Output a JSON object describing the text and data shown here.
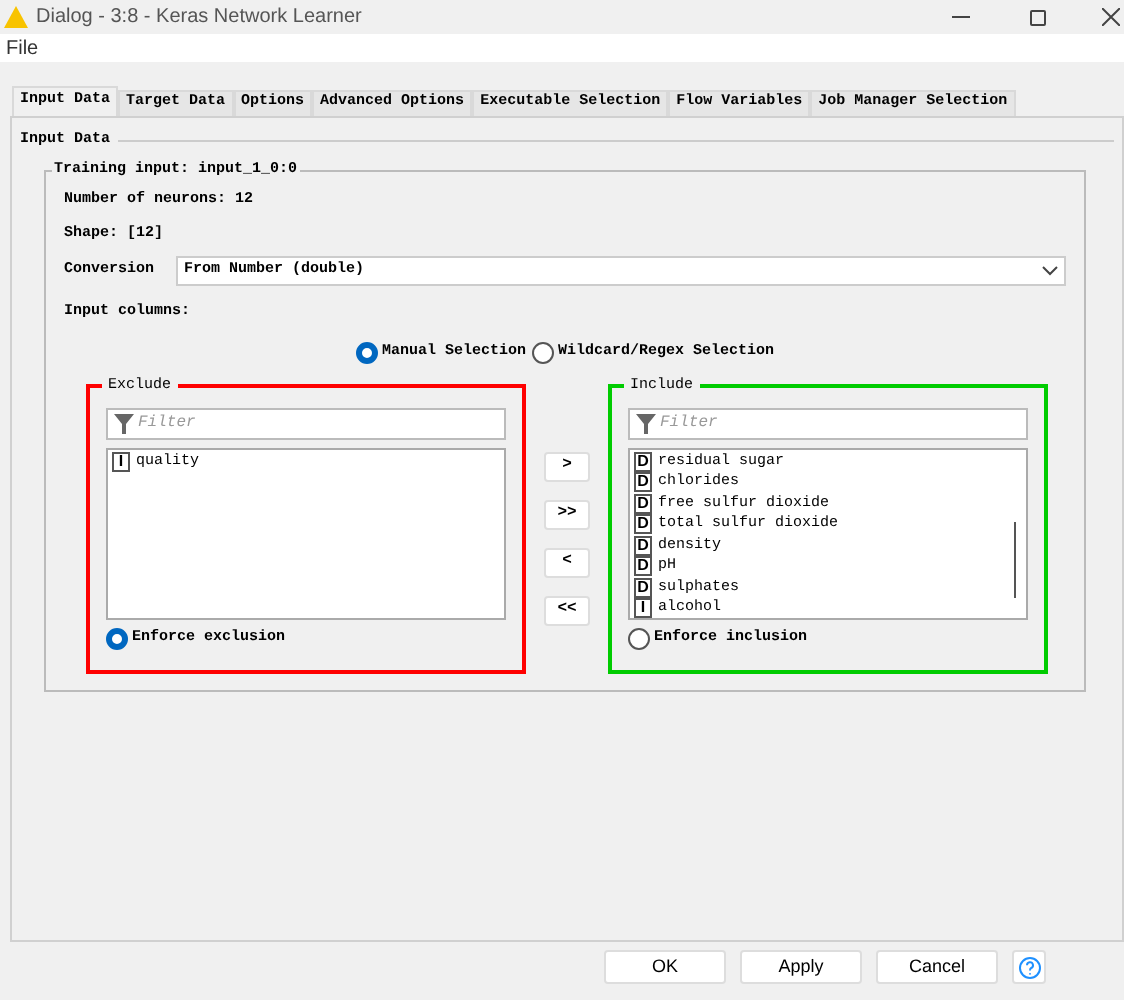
{
  "window": {
    "title": "Dialog - 3:8 - Keras Network Learner"
  },
  "menu": [
    "File"
  ],
  "tabs": [
    {
      "label": "Input Data",
      "selected": true
    },
    {
      "label": "Target Data",
      "selected": false
    },
    {
      "label": "Options",
      "selected": false
    },
    {
      "label": "Advanced Options",
      "selected": false
    },
    {
      "label": "Executable Selection",
      "selected": false
    },
    {
      "label": "Flow Variables",
      "selected": false
    },
    {
      "label": "Job Manager Selection",
      "selected": false
    }
  ],
  "panel": {
    "title": "Input Data",
    "group_title": "Training input: input_1_0:0",
    "neurons": "Number of neurons: 12",
    "shape": "Shape: [12]",
    "conversion_label": "Conversion",
    "conversion_value": "From Number (double)",
    "columns_label": "Input columns:",
    "modes": [
      {
        "label": "Manual Selection",
        "selected": true
      },
      {
        "label": "Wildcard/Regex Selection",
        "selected": false
      }
    ],
    "exclude": {
      "title": "Exclude",
      "color": "#ff0000",
      "placeholder": "Filter",
      "items": [
        {
          "type": "I",
          "name": "quality"
        }
      ],
      "enforce": {
        "label": "Enforce exclusion",
        "selected": true
      }
    },
    "include": {
      "title": "Include",
      "color": "#00cc00",
      "placeholder": "Filter",
      "items": [
        {
          "type": "D",
          "name": "residual sugar"
        },
        {
          "type": "D",
          "name": "chlorides"
        },
        {
          "type": "D",
          "name": "free sulfur dioxide"
        },
        {
          "type": "D",
          "name": "total sulfur dioxide"
        },
        {
          "type": "D",
          "name": "density"
        },
        {
          "type": "D",
          "name": "pH"
        },
        {
          "type": "D",
          "name": "sulphates"
        },
        {
          "type": "I",
          "name": "alcohol"
        }
      ],
      "enforce": {
        "label": "Enforce inclusion",
        "selected": false
      }
    },
    "move_buttons": [
      ">",
      ">>",
      "<",
      "<<"
    ]
  },
  "buttons": [
    "OK",
    "Apply",
    "Cancel"
  ]
}
